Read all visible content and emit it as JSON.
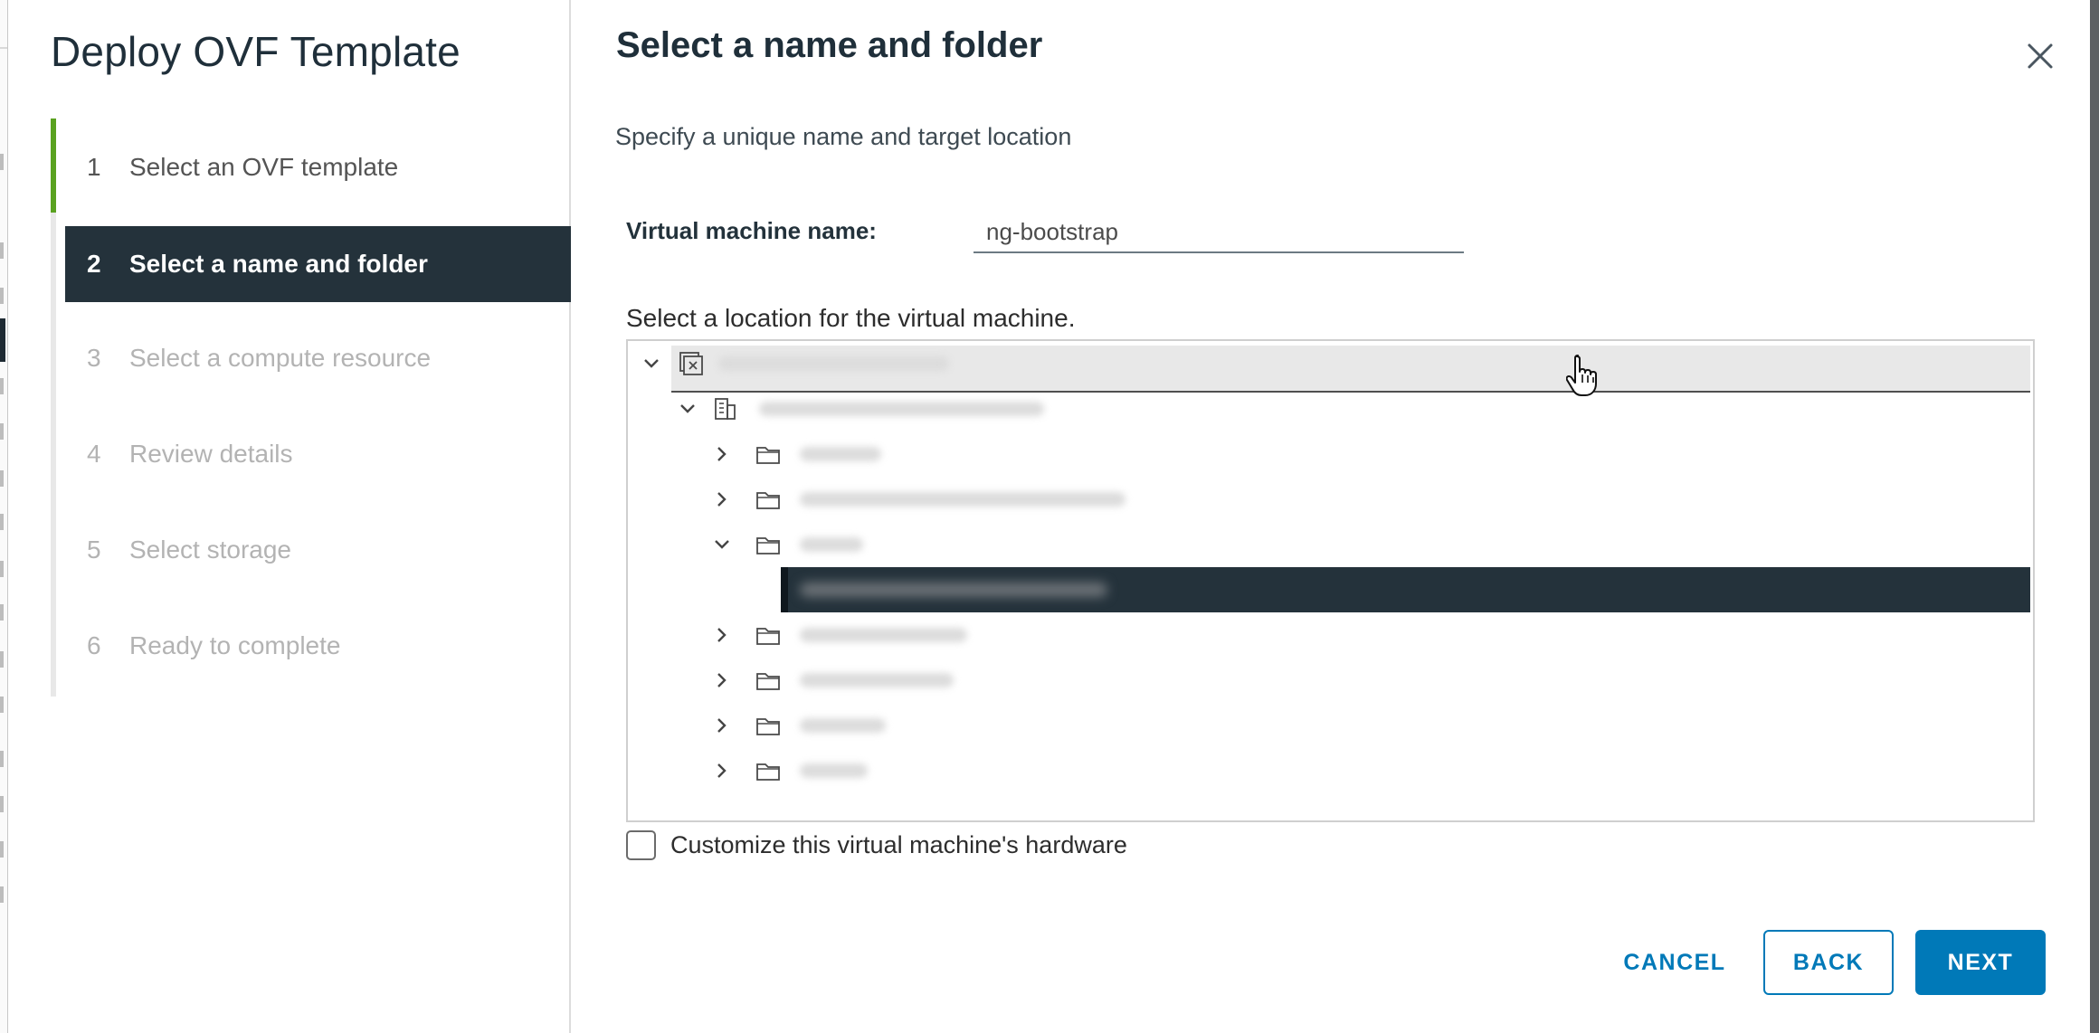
{
  "wizard": {
    "title": "Deploy OVF Template",
    "steps": [
      {
        "number": "1",
        "label": "Select an OVF template",
        "state": "completed"
      },
      {
        "number": "2",
        "label": "Select a name and folder",
        "state": "active"
      },
      {
        "number": "3",
        "label": "Select a compute resource",
        "state": "pending"
      },
      {
        "number": "4",
        "label": "Review details",
        "state": "pending"
      },
      {
        "number": "5",
        "label": "Select storage",
        "state": "pending"
      },
      {
        "number": "6",
        "label": "Ready to complete",
        "state": "pending"
      }
    ]
  },
  "page": {
    "title": "Select a name and folder",
    "subtitle": "Specify a unique name and target location"
  },
  "vm_name": {
    "label": "Virtual machine name:",
    "value": "ng-bootstrap"
  },
  "location": {
    "label": "Select a location for the virtual machine.",
    "tree": [
      {
        "icon": "vcenter-icon",
        "expanded": true,
        "selected": false
      },
      {
        "icon": "datacenter-icon",
        "expanded": true,
        "selected": false
      },
      {
        "icon": "folder-icon",
        "expanded": false,
        "selected": false
      },
      {
        "icon": "folder-icon",
        "expanded": false,
        "selected": false
      },
      {
        "icon": "folder-icon",
        "expanded": true,
        "selected": false
      },
      {
        "icon": "",
        "expanded": false,
        "selected": true
      },
      {
        "icon": "folder-icon",
        "expanded": false,
        "selected": false
      },
      {
        "icon": "folder-icon",
        "expanded": false,
        "selected": false
      },
      {
        "icon": "folder-icon",
        "expanded": false,
        "selected": false
      },
      {
        "icon": "folder-icon",
        "expanded": false,
        "selected": false
      }
    ]
  },
  "customize_hardware": {
    "label": "Customize this virtual machine's hardware",
    "checked": false
  },
  "footer": {
    "cancel_label": "CANCEL",
    "back_label": "BACK",
    "next_label": "NEXT"
  },
  "colors": {
    "accent": "#0079b8",
    "active_step_bg": "#24323b",
    "completed_step_bar": "#5aa220",
    "selected_row_bg": "#24323b"
  }
}
